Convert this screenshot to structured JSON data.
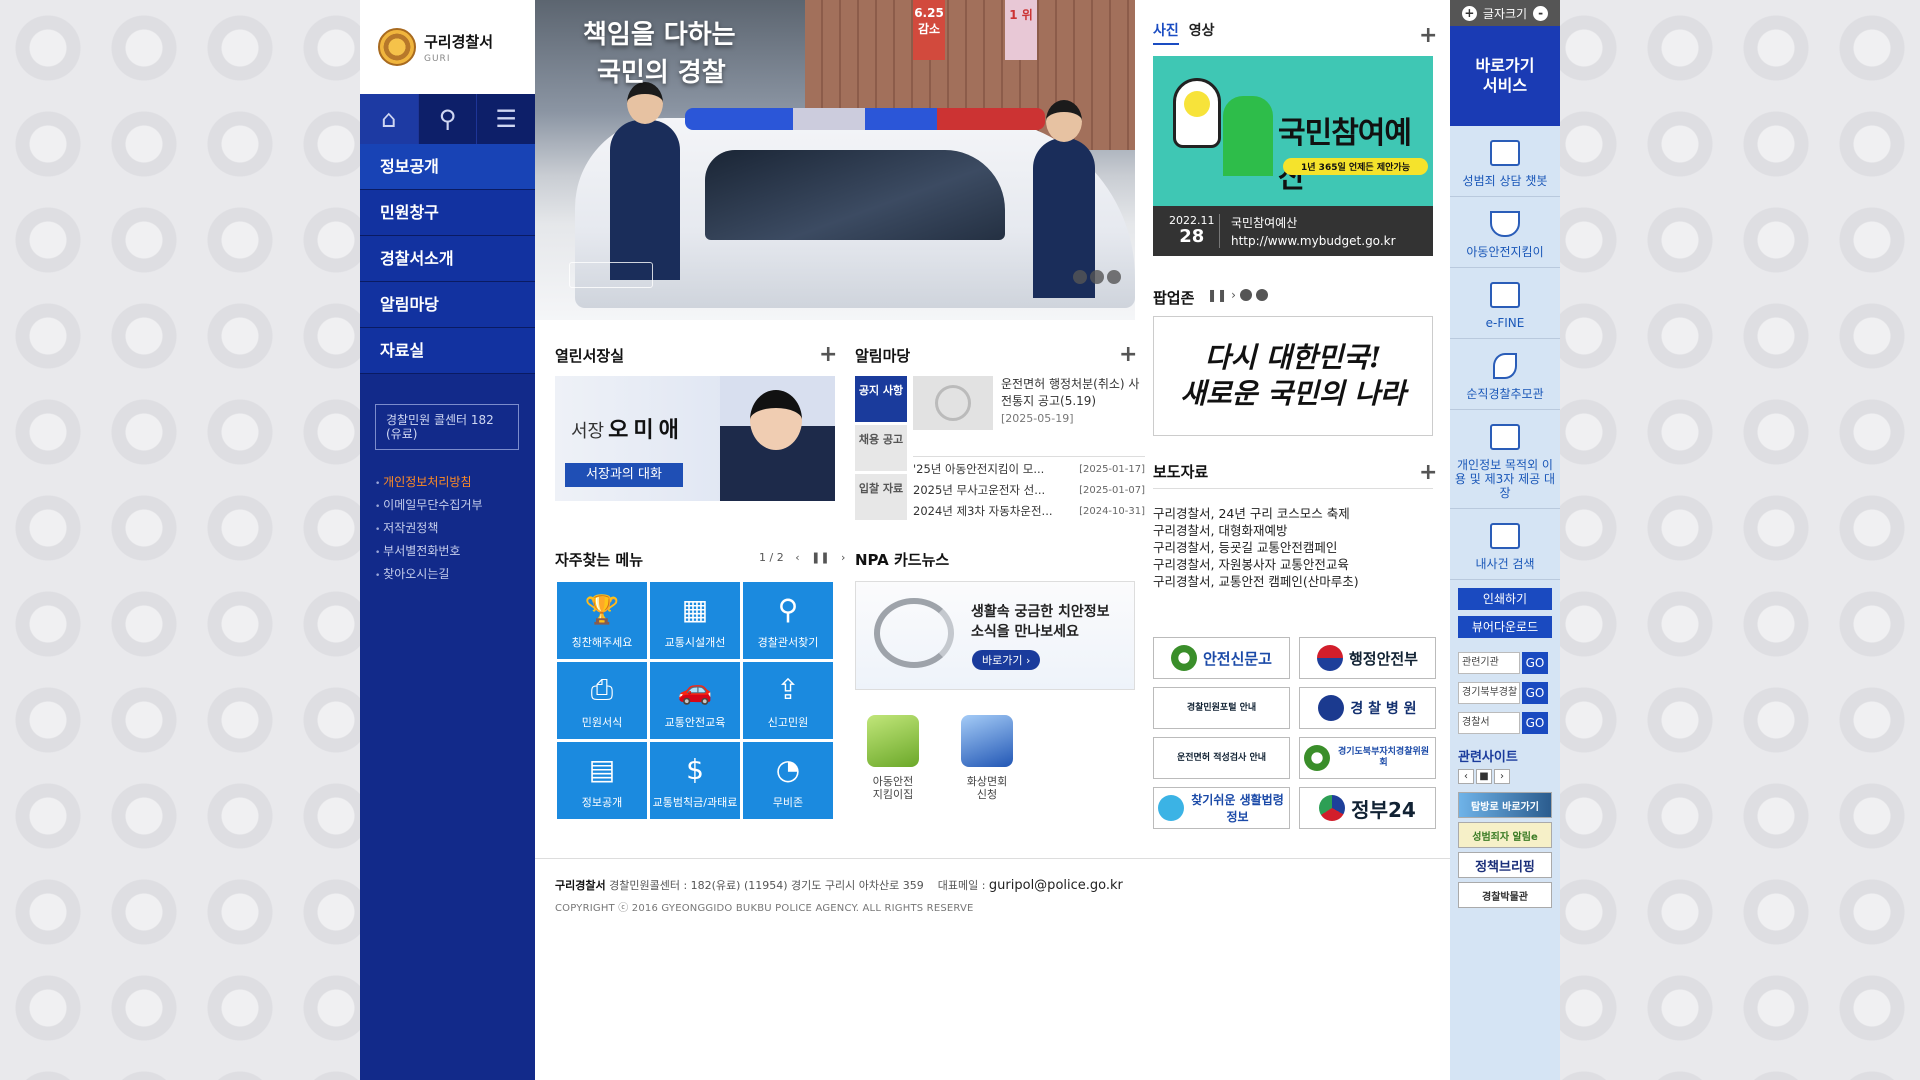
{
  "header": {
    "logo_title": "구리경찰서",
    "logo_sub": "GURI"
  },
  "sidebar": {
    "nav": [
      "정보공개",
      "민원창구",
      "경찰서소개",
      "알림마당",
      "자료실"
    ],
    "call_center": "경찰민원 콜센터 182 (유료)",
    "links": [
      "개인정보처리방침",
      "이메일무단수집거부",
      "저작권정책",
      "부서별전화번호",
      "찾아오시는길"
    ]
  },
  "hero": {
    "line1": "책임을 다하는",
    "line2": "국민의 경찰",
    "banner1": "6.25 감소",
    "banner2": "1 위"
  },
  "chief": {
    "title": "열린서장실",
    "prefix": "서장",
    "name": "오미애",
    "button": "서장과의 대화"
  },
  "notice": {
    "title": "알림마당",
    "tabs": [
      "공지 사항",
      "채용 공고",
      "입찰 자료"
    ],
    "top_item": "운전면허 행정처분(취소) 사전통지 공고(5.19)",
    "top_date": "[2025-05-19]",
    "items": [
      {
        "title": "'25년 아동안전지킴이 모...",
        "date": "[2025-01-17]"
      },
      {
        "title": "2025년 무사고운전자 선...",
        "date": "[2025-01-07]"
      },
      {
        "title": "2024년 제3차 자동차운전...",
        "date": "[2024-10-31]"
      }
    ]
  },
  "favorites": {
    "title": "자주찾는 메뉴",
    "page": "1 / 2",
    "items": [
      {
        "label": "칭찬해주세요",
        "icon": "trophy-icon"
      },
      {
        "label": "교통시설개선",
        "icon": "traffic-signal-icon"
      },
      {
        "label": "경찰관서찾기",
        "icon": "magnifier-icon"
      },
      {
        "label": "민원서식",
        "icon": "printer-icon"
      },
      {
        "label": "교통안전교육",
        "icon": "car-sign-icon"
      },
      {
        "label": "신고민원",
        "icon": "upload-folder-icon"
      },
      {
        "label": "정보공개",
        "icon": "monitor-grid-icon"
      },
      {
        "label": "교통범칙금/과태료",
        "icon": "money-bag-icon"
      },
      {
        "label": "무비존",
        "icon": "wifi-bubble-icon"
      }
    ]
  },
  "cardnews": {
    "title": "NPA 카드뉴스",
    "text_line1": "생활속 궁금한 치안정보",
    "text_line2": "소식을 만나보세요",
    "button": "바로가기 ›"
  },
  "apps": [
    {
      "label_1": "아동안전",
      "label_2": "지킴이집"
    },
    {
      "label_1": "화상면회",
      "label_2": "신청"
    }
  ],
  "photo": {
    "tab_active": "사진",
    "tab_inactive": "영상",
    "headline": "국민참여예산",
    "subhead": "1년 365일 언제든 제안가능",
    "date_month": "2022.11",
    "date_day": "28",
    "caption_title": "국민참여예산",
    "caption_url": "http://www.mybudget.go.kr"
  },
  "popup": {
    "title": "팝업존",
    "line1": "다시 대한민국!",
    "line2": "새로운 국민의 나라"
  },
  "press": {
    "title": "보도자료",
    "items": [
      "구리경찰서, 24년 구리 코스모스 축제",
      "구리경찰서, 대형화재예방",
      "구리경찰서, 등굣길 교통안전캠페인",
      "구리경찰서, 자원봉사자 교통안전교육",
      "구리경찰서, 교통안전 캠페인(산마루초)"
    ]
  },
  "logos": {
    "l1": "안전신문고",
    "l2": "행정안전부",
    "l3": "경찰민원포털 안내",
    "l4": "경 찰 병 원",
    "l5": "운전면허 적성검사 안내",
    "l6": "경기도북부자치경찰위원회",
    "l7": "찾기쉬운 생활법령정보",
    "l8": "정부24"
  },
  "footer": {
    "org": "구리경찰서",
    "info": "경찰민원콜센터 : 182(유료) (11954) 경기도 구리시 아차산로 359",
    "mail_label": "대표메일 :",
    "mail": "guripol@police.go.kr",
    "copyright": "COPYRIGHT ⓒ 2016 GYEONGGIDO BUKBU POLICE AGENCY. ALL RIGHTS RESERVE"
  },
  "quickbar": {
    "font_label": "글자크기",
    "plus": "+",
    "minus": "-",
    "service_title": "바로가기 서비스",
    "items": [
      "성범죄 상담 챗봇",
      "아동안전지킴이",
      "e-FINE",
      "순직경찰추모관",
      "개인정보 목적외 이용 및 제3자 제공 대장",
      "내사건 검색"
    ],
    "print": "인쇄하기",
    "viewer": "뷰어다운로드",
    "selects": [
      "관련기관",
      "경기북부경찰",
      "경찰서"
    ],
    "go": "GO",
    "related_title": "관련사이트",
    "related_ctrl": [
      "‹",
      "■",
      "›"
    ],
    "related": [
      "탐방로 바로가기",
      "성범죄자 알림e",
      "정책브리핑",
      "경찰박물관"
    ]
  },
  "colors": {
    "nav_bg": "#122a8a",
    "accent_blue": "#1b8adf",
    "highlight_orange": "#ff8b25",
    "photo_bg": "#3fc7b4"
  }
}
